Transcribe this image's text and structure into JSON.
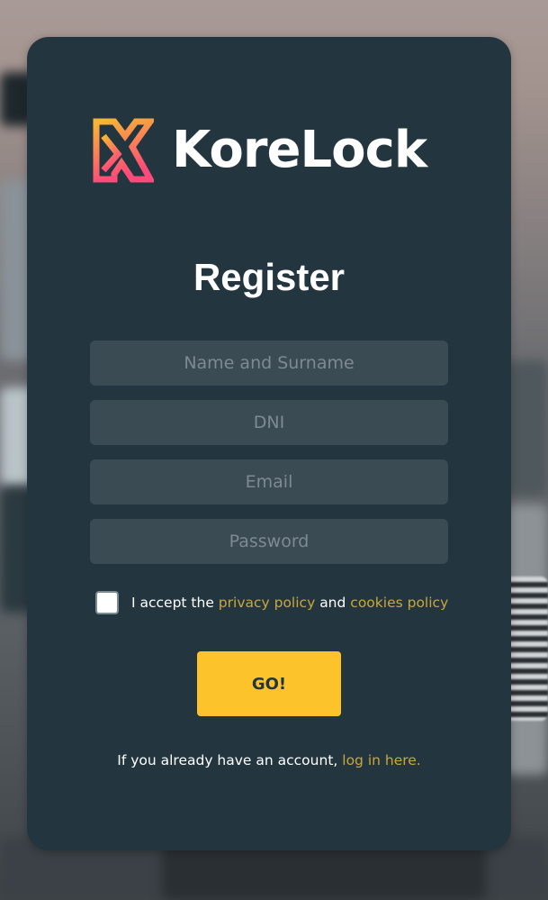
{
  "brand": {
    "name": "KoreLock",
    "logo_icon": "korelock-k-icon",
    "gradient_colors": [
      "#f7b733",
      "#fc4a7a"
    ]
  },
  "form": {
    "title": "Register",
    "fields": [
      {
        "placeholder": "Name and Surname",
        "value": ""
      },
      {
        "placeholder": "DNI",
        "value": ""
      },
      {
        "placeholder": "Email",
        "value": ""
      },
      {
        "placeholder": "Password",
        "value": ""
      }
    ],
    "terms": {
      "checked": false,
      "prefix": "I accept the",
      "privacy_link": "privacy policy",
      "conjunction": "and",
      "cookies_link": "cookies policy"
    },
    "submit_label": "GO!",
    "login_prompt": "If you already have an account,",
    "login_link": "log in here."
  },
  "colors": {
    "card_background": "#233640",
    "field_background": "#3b4b54",
    "accent_button": "#fcc42a",
    "link": "#caa73a"
  }
}
